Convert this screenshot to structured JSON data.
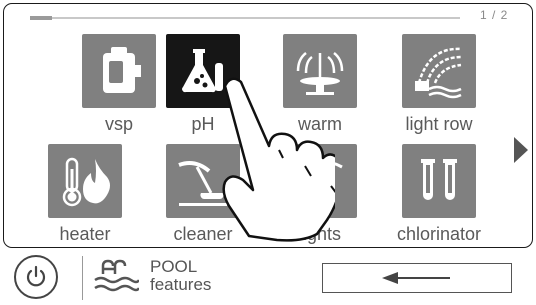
{
  "page": {
    "indicator": "1 / 2",
    "progress_fraction": 0.05
  },
  "tiles": [
    {
      "label": "vsp",
      "icon": "pump-icon",
      "active": false
    },
    {
      "label": "pH",
      "icon": "flask-icon",
      "active": true
    },
    {
      "label": "warm",
      "icon": "fountain-icon",
      "active": false
    },
    {
      "label": "light row",
      "icon": "water-jets-icon",
      "active": false
    },
    {
      "label": "heater",
      "icon": "thermometer-flame-icon",
      "active": false
    },
    {
      "label": "cleaner",
      "icon": "pool-cleaner-icon",
      "active": false
    },
    {
      "label": "lights",
      "icon": "pool-light-icon",
      "active": false
    },
    {
      "label": "chlorinator",
      "icon": "test-tubes-icon",
      "active": false
    }
  ],
  "bottom": {
    "power_icon": "power-icon",
    "section_icon": "pool-ladder-icon",
    "section_line1": "POOL",
    "section_line2": "features",
    "back_icon": "arrow-left-icon"
  },
  "colors": {
    "tile": "#808080",
    "tile_active": "#161616",
    "text": "#5a5a5a"
  }
}
